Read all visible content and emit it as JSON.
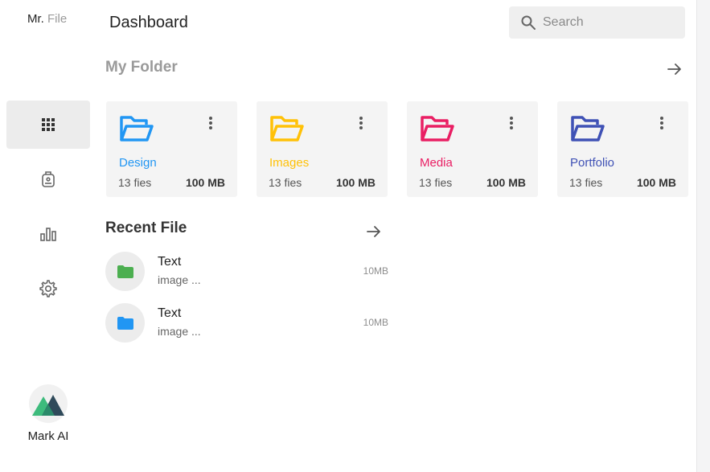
{
  "app": {
    "brand_main": "Mr.",
    "brand_sub": "File"
  },
  "header": {
    "title": "Dashboard",
    "search_placeholder": "Search"
  },
  "sidebar": {
    "items": [
      {
        "icon": "grid-icon",
        "active": true
      },
      {
        "icon": "badge-icon",
        "active": false
      },
      {
        "icon": "bar-chart-icon",
        "active": false
      },
      {
        "icon": "gear-icon",
        "active": false
      }
    ],
    "user": {
      "name": "Mark AI"
    }
  },
  "folders_section": {
    "title": "My Folder"
  },
  "folders": [
    {
      "name": "Design",
      "count": "13 fies",
      "size": "100 MB",
      "color": "#2196f3"
    },
    {
      "name": "Images",
      "count": "13 fies",
      "size": "100 MB",
      "color": "#ffc107"
    },
    {
      "name": "Media",
      "count": "13 fies",
      "size": "100 MB",
      "color": "#e91e63"
    },
    {
      "name": "Portfolio",
      "count": "13 fies",
      "size": "100 MB",
      "color": "#3f51b5"
    }
  ],
  "recent_section": {
    "title": "Recent File"
  },
  "recent": [
    {
      "name": "Text",
      "type": "image ...",
      "size": "10MB",
      "color": "#4caf50"
    },
    {
      "name": "Text",
      "type": "image ...",
      "size": "10MB",
      "color": "#2196f3"
    }
  ]
}
